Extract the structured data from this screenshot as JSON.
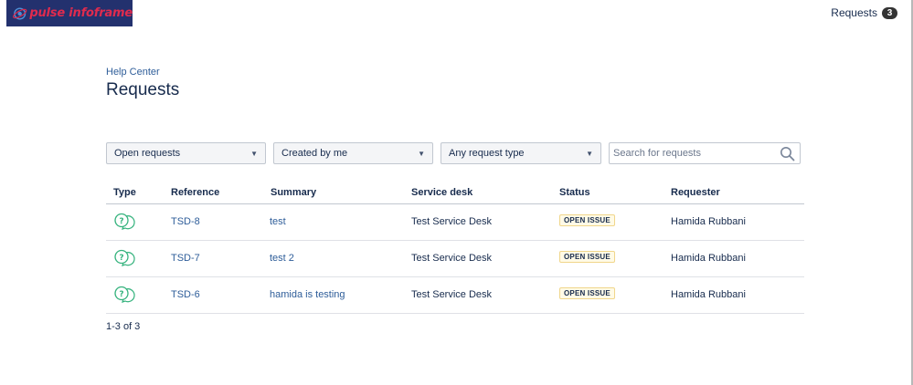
{
  "header": {
    "logo_text": "pulse infoframe",
    "requests_label": "Requests",
    "requests_count": "3"
  },
  "breadcrumb": "Help Center",
  "page_title": "Requests",
  "filters": {
    "status": "Open requests",
    "creator": "Created by me",
    "type": "Any request type",
    "search_placeholder": "Search for requests"
  },
  "table": {
    "columns": [
      "Type",
      "Reference",
      "Summary",
      "Service desk",
      "Status",
      "Requester"
    ],
    "rows": [
      {
        "type_icon": "question-bubble-icon",
        "reference": "TSD-8",
        "summary": "test",
        "service_desk": "Test Service Desk",
        "status": "OPEN ISSUE",
        "requester": "Hamida Rubbani"
      },
      {
        "type_icon": "question-bubble-icon",
        "reference": "TSD-7",
        "summary": "test 2",
        "service_desk": "Test Service Desk",
        "status": "OPEN ISSUE",
        "requester": "Hamida Rubbani"
      },
      {
        "type_icon": "question-bubble-icon",
        "reference": "TSD-6",
        "summary": "hamida is testing",
        "service_desk": "Test Service Desk",
        "status": "OPEN ISSUE",
        "requester": "Hamida Rubbani"
      }
    ]
  },
  "pagination": "1-3 of 3",
  "colors": {
    "logo_bg": "#23316e",
    "logo_text": "#e02b4e",
    "link": "#2e5d99",
    "icon_green": "#36b37e",
    "lozenge_bg": "#fffae6"
  }
}
